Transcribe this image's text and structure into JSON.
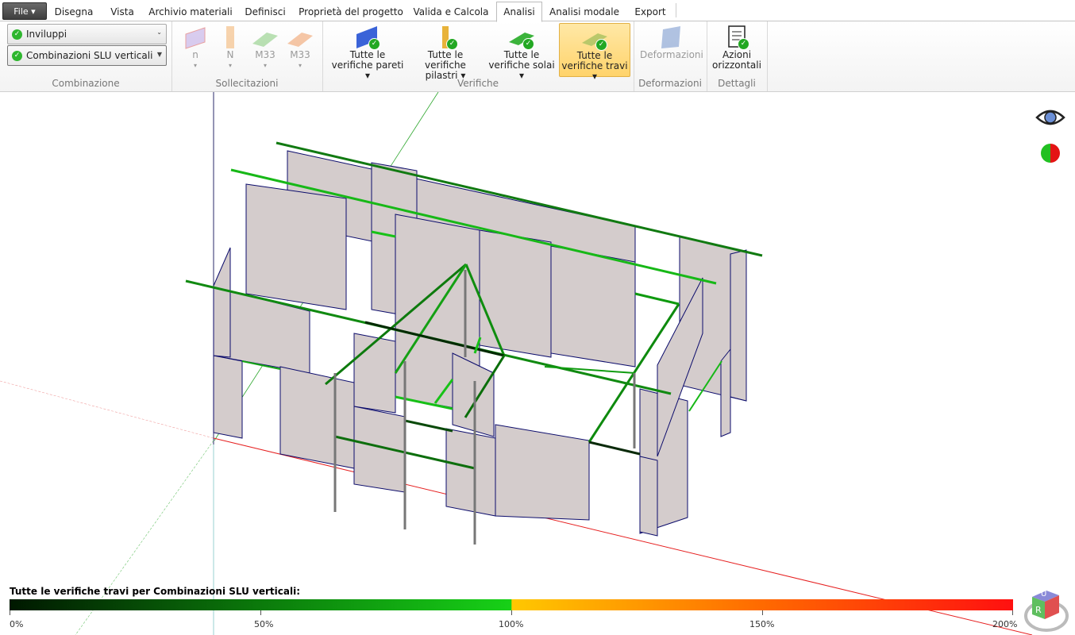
{
  "menu": {
    "file_label": "File ▾"
  },
  "tabs": [
    {
      "label": "Disegna"
    },
    {
      "label": "Vista"
    },
    {
      "label": "Archivio materiali"
    },
    {
      "label": "Definisci"
    },
    {
      "label": "Proprietà del progetto"
    },
    {
      "label": "Valida e Calcola"
    },
    {
      "label": "Analisi"
    },
    {
      "label": "Analisi modale"
    },
    {
      "label": "Export"
    }
  ],
  "active_tab": "Analisi",
  "ribbon": {
    "combinazione": {
      "label": "Combinazione",
      "combo1": "Inviluppi",
      "combo2": "Combinazioni SLU verticali"
    },
    "sollecitazioni": {
      "label": "Sollecitazioni",
      "buttons": [
        {
          "label": "n"
        },
        {
          "label": "N"
        },
        {
          "label": "M33"
        },
        {
          "label": "M33"
        }
      ]
    },
    "verifiche": {
      "label": "Verifiche",
      "buttons": [
        {
          "line1": "Tutte le",
          "line2": "verifiche pareti ▾"
        },
        {
          "line1": "Tutte le",
          "line2": "verifiche pilastri ▾"
        },
        {
          "line1": "Tutte le",
          "line2": "verifiche solai ▾"
        },
        {
          "line1": "Tutte le",
          "line2": "verifiche travi ▾"
        }
      ]
    },
    "deformazioni": {
      "label": "Deformazioni",
      "button": "Deformazioni"
    },
    "dettagli": {
      "label": "Dettagli",
      "line1": "Azioni",
      "line2": "orizzontali"
    }
  },
  "legend": {
    "title": "Tutte le verifiche travi per Combinazioni SLU verticali:",
    "ticks": [
      "0%",
      "50%",
      "100%",
      "150%",
      "200%"
    ]
  },
  "nav_cube": {
    "letter_top": "U",
    "letter_front": "R"
  },
  "colors": {
    "accent_tab": "#1a7a1a",
    "beam_green": "#0aa00a",
    "wall": "#d4cccc",
    "wall_edge": "#0b0b6b"
  }
}
